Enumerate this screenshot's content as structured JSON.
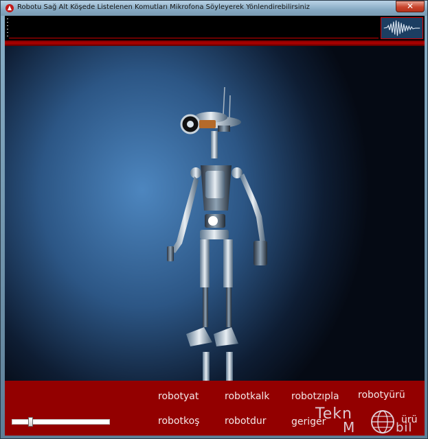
{
  "window": {
    "title": "Robotu Sağ Alt Köşede Listelenen Komutları Mikrofona Söyleyerek Yönlendirebilirsiniz",
    "close_symbol": "✕",
    "icon": "app-icon"
  },
  "commands": [
    {
      "label": "robotyat"
    },
    {
      "label": "robotkalk"
    },
    {
      "label": "robotzıpla"
    },
    {
      "label": "robotyürü"
    },
    {
      "label": "robotkoş"
    },
    {
      "label": "robotdur"
    },
    {
      "label": "geriger"
    },
    {
      "label": "ürü"
    }
  ],
  "volume": {
    "level": 0.18
  },
  "watermark": {
    "line1": "Tekn",
    "line2": "M",
    "line3": "bil"
  },
  "colors": {
    "control_panel": "#930000",
    "separator": "#b10000",
    "accent": "#d60000"
  }
}
